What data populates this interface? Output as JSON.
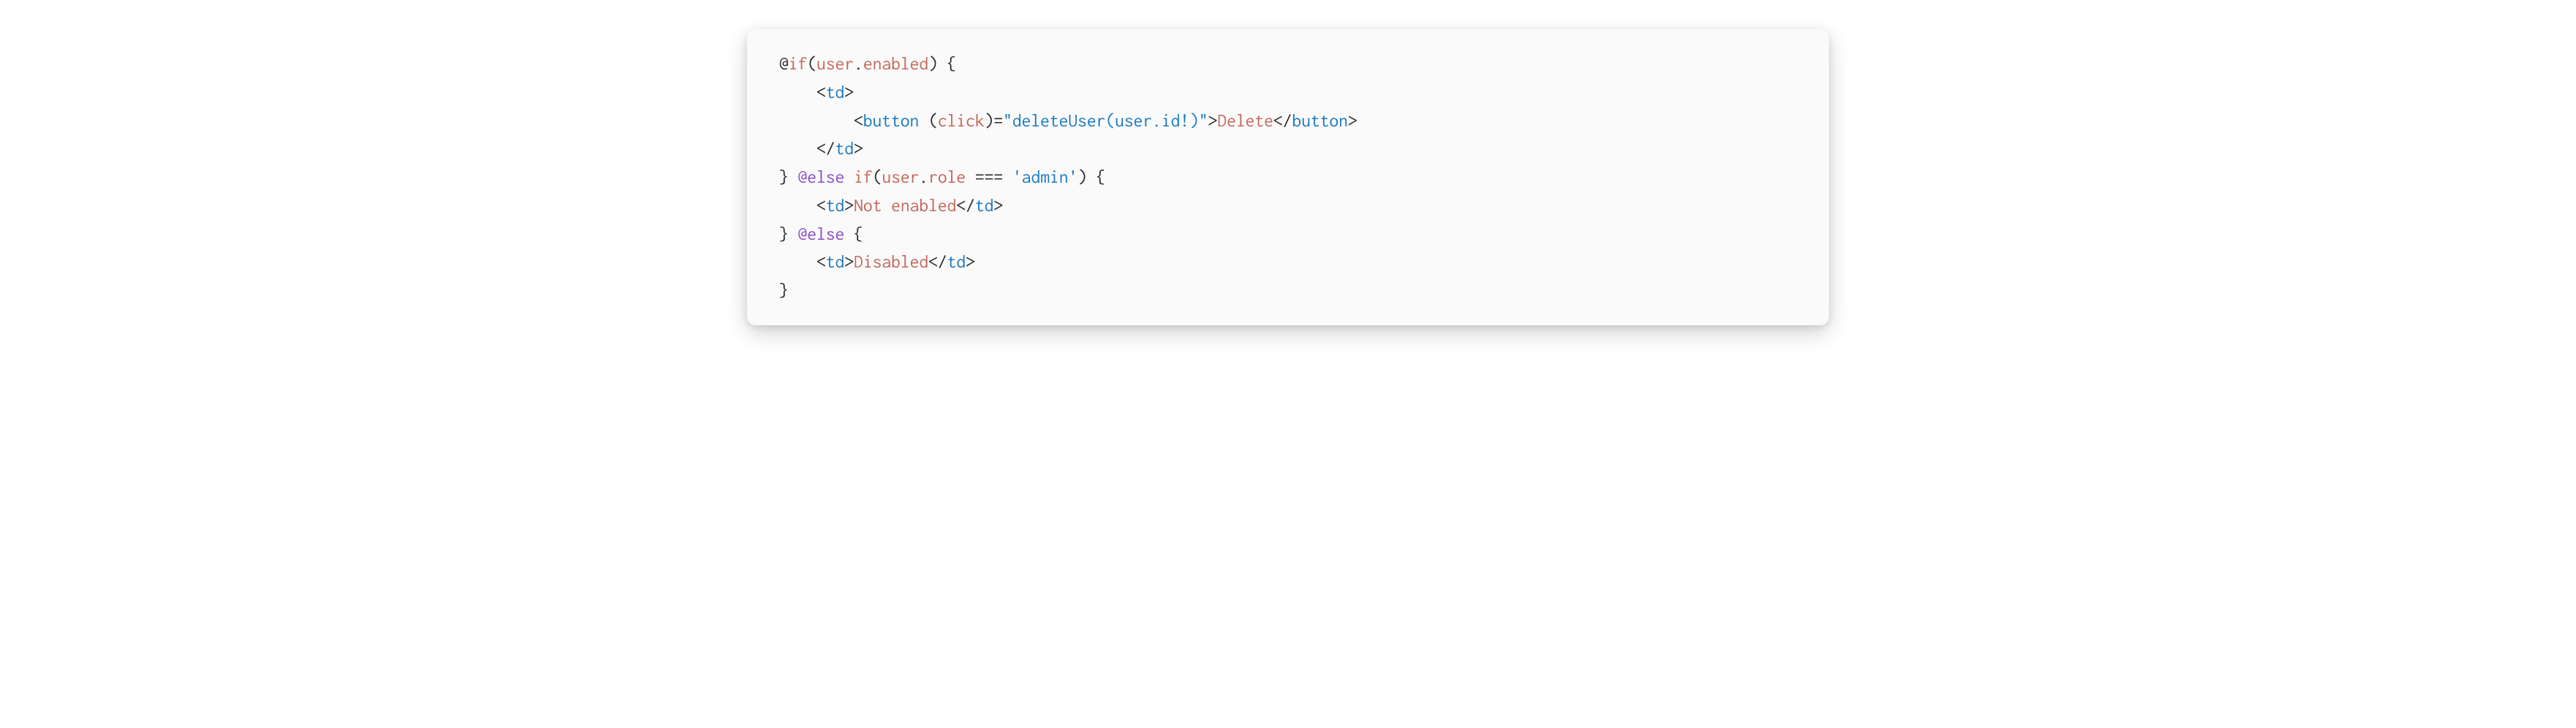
{
  "code": {
    "line1": {
      "at": "@",
      "if": "if",
      "lparen": "(",
      "user": "user",
      "dot": ".",
      "enabled": "enabled",
      "rparen": ")",
      "space": " ",
      "lbrace": "{"
    },
    "line2": {
      "lt": "<",
      "td": "td",
      "gt": ">"
    },
    "line3": {
      "lt": "<",
      "button": "button",
      "space": " ",
      "lparen": "(",
      "click": "click",
      "rparen": ")",
      "eq": "=",
      "q1": "\"",
      "deleteUser": "deleteUser(user.id!)",
      "q2": "\"",
      "gt": ">",
      "text": "Delete",
      "clt": "</",
      "cbutton": "button",
      "cgt": ">"
    },
    "line4": {
      "clt": "</",
      "td": "td",
      "cgt": ">"
    },
    "line5": {
      "rbrace": "}",
      "space": " ",
      "else": "@else",
      "space2": " ",
      "if": "if",
      "lparen": "(",
      "user": "user",
      "dot": ".",
      "role": "role",
      "space3": " ",
      "eqeq": "===",
      "space4": " ",
      "squote1": "'",
      "admin": "admin",
      "squote2": "'",
      "rparen": ")",
      "space5": " ",
      "lbrace": "{"
    },
    "line6": {
      "lt": "<",
      "td": "td",
      "gt": ">",
      "text": "Not enabled",
      "clt": "</",
      "ctd": "td",
      "cgt": ">"
    },
    "line7": {
      "rbrace": "}",
      "space": " ",
      "else": "@else",
      "space2": " ",
      "lbrace": "{"
    },
    "line8": {
      "lt": "<",
      "td": "td",
      "gt": ">",
      "text": "Disabled",
      "clt": "</",
      "ctd": "td",
      "cgt": ">"
    },
    "line9": {
      "rbrace": "}"
    }
  }
}
